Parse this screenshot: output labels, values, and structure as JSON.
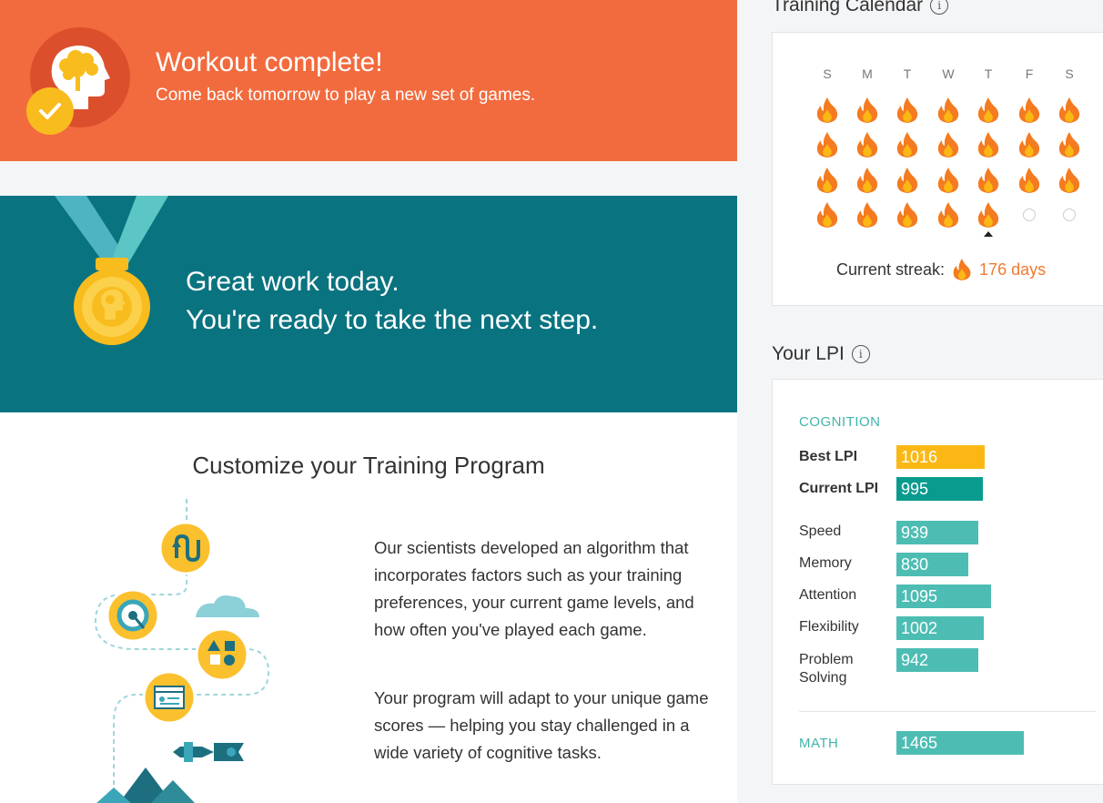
{
  "banner": {
    "title": "Workout complete!",
    "subtitle": "Come back tomorrow to play a new set of games."
  },
  "achievement": {
    "line1": "Great work today.",
    "line2": "You're ready to take the next step."
  },
  "customize": {
    "title": "Customize your Training Program",
    "paragraph1": "Our scientists developed an algorithm that incorporates factors such as your training preferences, your current game levels, and how often you've played each game.",
    "paragraph2": "Your program will adapt to your unique game scores — helping you stay challenged in a wide variety of cognitive tasks."
  },
  "calendar": {
    "title": "Training Calendar",
    "days": [
      "S",
      "M",
      "T",
      "W",
      "T",
      "F",
      "S"
    ],
    "weeks": [
      [
        true,
        true,
        true,
        true,
        true,
        true,
        true
      ],
      [
        true,
        true,
        true,
        true,
        true,
        true,
        true
      ],
      [
        true,
        true,
        true,
        true,
        true,
        true,
        true
      ],
      [
        true,
        true,
        true,
        true,
        true,
        false,
        false
      ]
    ],
    "today_week": 3,
    "today_day": 4,
    "streak_label": "Current streak:",
    "streak_value": "176 days"
  },
  "lpi": {
    "title": "Your LPI",
    "cognition_label": "COGNITION",
    "best_label": "Best LPI",
    "best_value": "1016",
    "current_label": "Current LPI",
    "current_value": "995",
    "categories": [
      {
        "label": "Speed",
        "value": "939"
      },
      {
        "label": "Memory",
        "value": "830"
      },
      {
        "label": "Attention",
        "value": "1095"
      },
      {
        "label": "Flexibility",
        "value": "1002"
      },
      {
        "label": "Problem Solving",
        "value": "942"
      }
    ],
    "math_label": "MATH",
    "math_value": "1465",
    "colors": {
      "best": "#fbb815",
      "current": "#0a9b8f",
      "category": "#4dbdb4"
    }
  },
  "icons": {
    "banner": "brain-logo-icon",
    "check": "check-icon",
    "medal": "medal-icon",
    "info": "info-icon",
    "flame": "flame-icon"
  }
}
